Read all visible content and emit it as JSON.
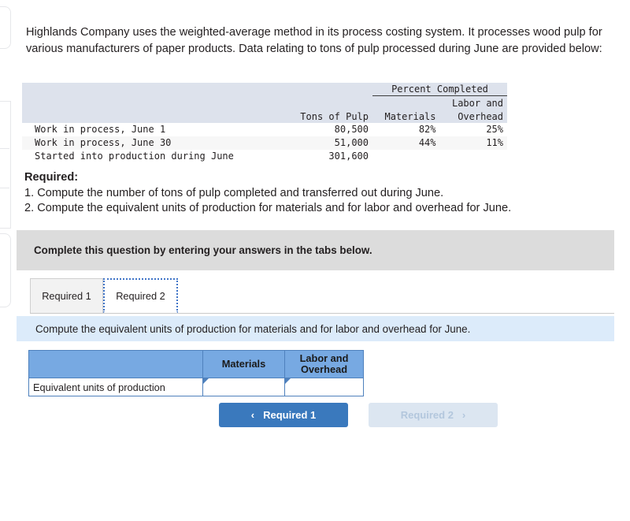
{
  "intro": {
    "paragraph": "Highlands Company uses the weighted-average method in its process costing system. It processes wood pulp for various manufacturers of paper products. Data relating to tons of pulp processed during June are provided below:"
  },
  "data_table": {
    "group_header": "Percent Completed",
    "columns": {
      "blank": "",
      "tons": "Tons of Pulp",
      "materials": "Materials",
      "labor_line1": "Labor and",
      "labor_line2": "Overhead"
    },
    "rows": [
      {
        "label": "Work in process, June 1",
        "tons": "80,500",
        "materials": "82%",
        "labor": "25%"
      },
      {
        "label": "Work in process, June 30",
        "tons": "51,000",
        "materials": "44%",
        "labor": "11%"
      },
      {
        "label": "Started into production during June",
        "tons": "301,600",
        "materials": "",
        "labor": ""
      }
    ]
  },
  "required": {
    "title": "Required:",
    "item_1": "1. Compute the number of tons of pulp completed and transferred out during June.",
    "item_2": "2. Compute the equivalent units of production for materials and for labor and overhead for June."
  },
  "complete_banner": {
    "text": "Complete this question by entering your answers in the tabs below."
  },
  "tabs": [
    {
      "label": "Required 1",
      "active": false
    },
    {
      "label": "Required 2",
      "active": true
    }
  ],
  "question_strip": {
    "text": "Compute the equivalent units of production for materials and for labor and overhead for June."
  },
  "answer_table": {
    "headers": {
      "blank": "",
      "materials": "Materials",
      "labor_line1": "Labor and",
      "labor_line2": "Overhead"
    },
    "row": {
      "label": "Equivalent units of production",
      "materials_value": "",
      "labor_value": "",
      "materials_placeholder": "",
      "labor_placeholder": ""
    }
  },
  "nav": {
    "prev_label": "Required 1",
    "prev_chevron": "‹",
    "next_label": "Required 2",
    "next_chevron": "›"
  },
  "colors": {
    "primary_blue": "#3a79bd",
    "table_header_blue": "#77a9e2",
    "question_strip_blue": "#dcebfa",
    "banner_grey": "#dcdcdc",
    "data_header_grey": "#dde2ec",
    "next_disabled": "#dce6f1"
  }
}
